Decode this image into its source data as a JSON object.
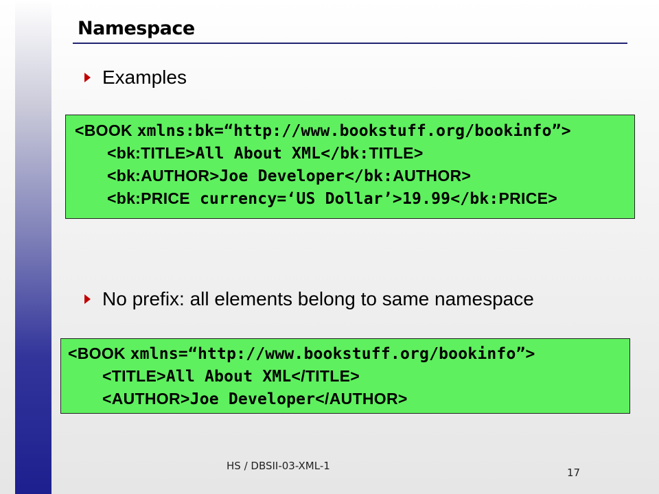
{
  "slide": {
    "title": "Namespace",
    "footer": "HS / DBSII-03-XML-1",
    "page_number": "17"
  },
  "bullets": [
    {
      "text": "Examples"
    },
    {
      "text": "No prefix: all elements belong to same namespace"
    }
  ],
  "code1": {
    "l1": {
      "open": "<BOOK ",
      "rest": "xmlns:bk=“http://www.bookstuff.org/bookinfo”>"
    },
    "l2": {
      "t1": "<bk:",
      "t2": "TITLE",
      "t3": ">All About XML</bk:",
      "t4": "TITLE",
      "t5": ">"
    },
    "l3": {
      "t1": "<bk:",
      "t2": "AUTHOR",
      "t3": ">Joe Developer</bk:",
      "t4": "AUTHOR",
      "t5": ">"
    },
    "l4": {
      "t1": "<bk:",
      "t2": "PRICE",
      "t3": " currency=‘US Dollar’>19.99</bk:",
      "t4": "PRICE",
      "t5": ">"
    }
  },
  "code2": {
    "l1": {
      "open": "<BOOK ",
      "rest": "xmlns=“http://www.bookstuff.org/bookinfo”>"
    },
    "l2": {
      "t1": "<TITLE>",
      "t2": "All About XML",
      "t3": "</TITLE>"
    },
    "l3": {
      "t1": "<AUTHOR>",
      "t2": "Joe Developer",
      "t3": "</AUTHOR>"
    }
  },
  "colors": {
    "code_background": "#5ff05f",
    "bullet_arrow": "#c00000",
    "sidebar_dark": "#1d1f8f"
  }
}
